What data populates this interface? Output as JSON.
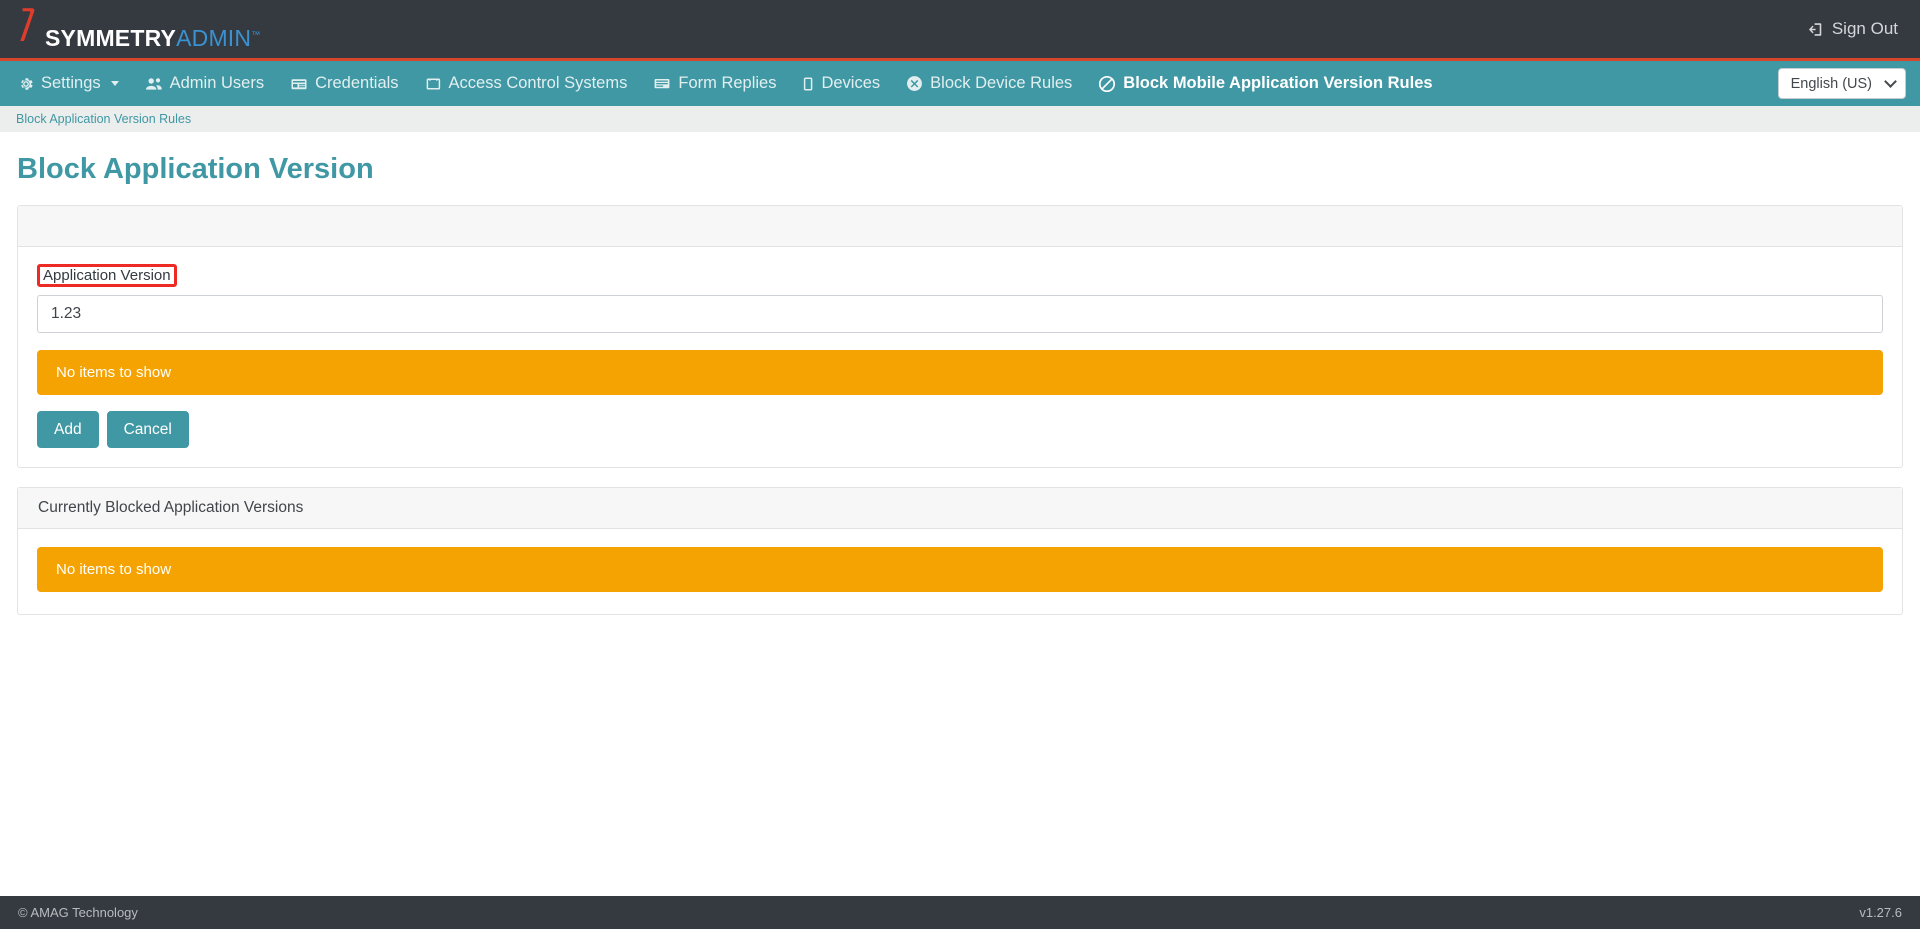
{
  "topbar": {
    "logo_symmetry": "SYMMETRY",
    "logo_admin": "ADMIN",
    "logo_tm": "™",
    "signout_label": "Sign Out",
    "accent_red": "#d9452a",
    "dark_bg": "#343a40"
  },
  "nav": {
    "teal": "#3f98a3",
    "items": [
      {
        "label": "Settings",
        "icon": "gear-icon",
        "has_caret": true,
        "active": false
      },
      {
        "label": "Admin Users",
        "icon": "users-icon",
        "has_caret": false,
        "active": false
      },
      {
        "label": "Credentials",
        "icon": "card-icon",
        "has_caret": false,
        "active": false
      },
      {
        "label": "Access Control Systems",
        "icon": "panel-icon",
        "has_caret": false,
        "active": false
      },
      {
        "label": "Form Replies",
        "icon": "monitor-icon",
        "has_caret": false,
        "active": false
      },
      {
        "label": "Devices",
        "icon": "mobile-icon",
        "has_caret": false,
        "active": false
      },
      {
        "label": "Block Device Rules",
        "icon": "circle-x-icon",
        "has_caret": false,
        "active": false
      },
      {
        "label": "Block Mobile Application Version Rules",
        "icon": "ban-icon",
        "has_caret": false,
        "active": true
      }
    ],
    "language": {
      "selected": "English (US)"
    }
  },
  "breadcrumb": {
    "label": "Block Application Version Rules"
  },
  "page": {
    "title": "Block Application Version"
  },
  "form_card": {
    "header_label": "",
    "field_label": "Application Version",
    "field_value": "1.23",
    "field_placeholder": "",
    "alert_text": "No items to show",
    "alert_color": "#f5a302",
    "add_label": "Add",
    "cancel_label": "Cancel",
    "highlight_color": "#ed2b24"
  },
  "blocked_card": {
    "header_label": "Currently Blocked Application Versions",
    "alert_text": "No items to show"
  },
  "footer": {
    "copyright": "© AMAG Technology",
    "version": "v1.27.6"
  }
}
